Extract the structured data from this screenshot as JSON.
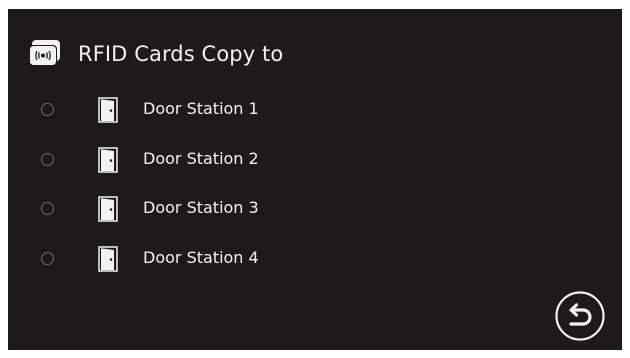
{
  "header": {
    "icon": "rfid-card-icon",
    "title": "RFID Cards Copy to"
  },
  "stations": [
    {
      "label": "Door Station 1",
      "icon": "door-icon",
      "selected": false
    },
    {
      "label": "Door Station 2",
      "icon": "door-icon",
      "selected": false
    },
    {
      "label": "Door Station 3",
      "icon": "door-icon",
      "selected": false
    },
    {
      "label": "Door Station 4",
      "icon": "door-icon",
      "selected": false
    }
  ],
  "footer": {
    "back_icon": "return-arrow-icon"
  },
  "colors": {
    "background": "#1c1a1b",
    "text": "#f2f2f2",
    "radio_border": "#6f6d6e"
  }
}
